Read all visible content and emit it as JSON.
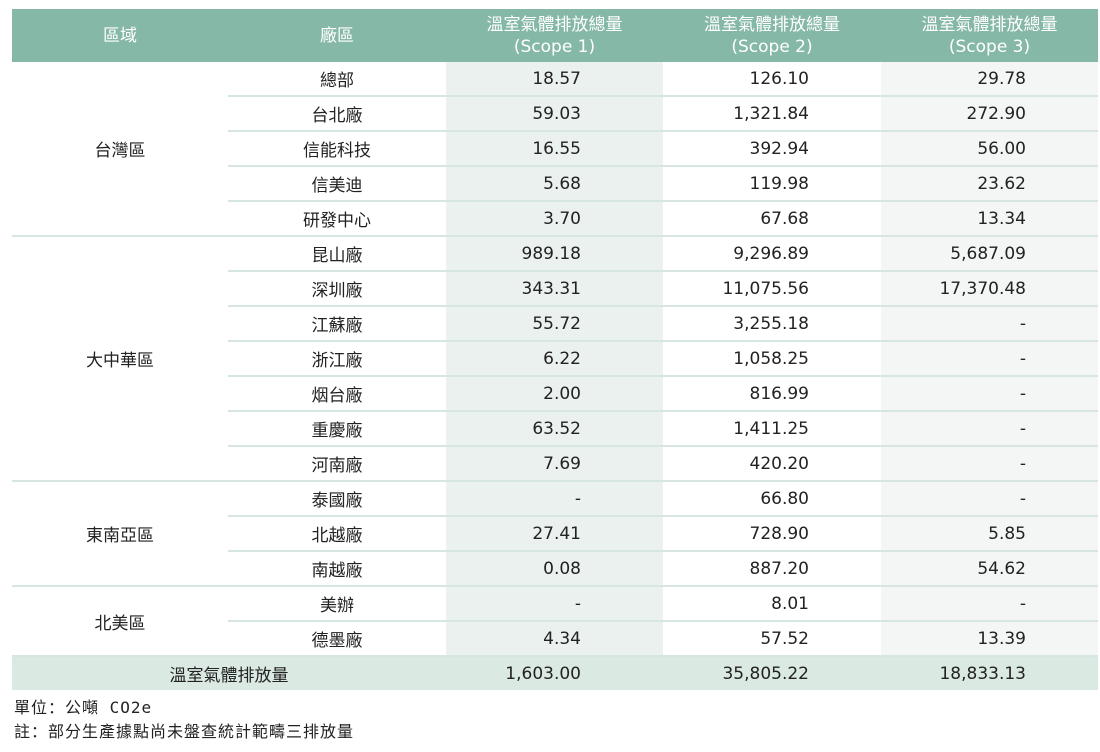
{
  "header": {
    "region": "區域",
    "plant": "廠區",
    "scope1_title": "溫室氣體排放總量",
    "scope1_sub": "(Scope 1)",
    "scope2_title": "溫室氣體排放總量",
    "scope2_sub": "(Scope 2)",
    "scope3_title": "溫室氣體排放總量",
    "scope3_sub": "(Scope 3)"
  },
  "groups": [
    {
      "region": "台灣區",
      "rows": [
        {
          "plant": "總部",
          "s1": "18.57",
          "s2": "126.10",
          "s3": "29.78"
        },
        {
          "plant": "台北廠",
          "s1": "59.03",
          "s2": "1,321.84",
          "s3": "272.90"
        },
        {
          "plant": "信能科技",
          "s1": "16.55",
          "s2": "392.94",
          "s3": "56.00"
        },
        {
          "plant": "信美迪",
          "s1": "5.68",
          "s2": "119.98",
          "s3": "23.62"
        },
        {
          "plant": "研發中心",
          "s1": "3.70",
          "s2": "67.68",
          "s3": "13.34"
        }
      ]
    },
    {
      "region": "大中華區",
      "rows": [
        {
          "plant": "昆山廠",
          "s1": "989.18",
          "s2": "9,296.89",
          "s3": "5,687.09"
        },
        {
          "plant": "深圳廠",
          "s1": "343.31",
          "s2": "11,075.56",
          "s3": "17,370.48"
        },
        {
          "plant": "江蘇廠",
          "s1": "55.72",
          "s2": "3,255.18",
          "s3": "-"
        },
        {
          "plant": "浙江廠",
          "s1": "6.22",
          "s2": "1,058.25",
          "s3": "-"
        },
        {
          "plant": "烟台廠",
          "s1": "2.00",
          "s2": "816.99",
          "s3": "-"
        },
        {
          "plant": "重慶廠",
          "s1": "63.52",
          "s2": "1,411.25",
          "s3": "-"
        },
        {
          "plant": "河南廠",
          "s1": "7.69",
          "s2": "420.20",
          "s3": "-"
        }
      ]
    },
    {
      "region": "東南亞區",
      "rows": [
        {
          "plant": "泰國廠",
          "s1": "-",
          "s2": "66.80",
          "s3": "-"
        },
        {
          "plant": "北越廠",
          "s1": "27.41",
          "s2": "728.90",
          "s3": "5.85"
        },
        {
          "plant": "南越廠",
          "s1": "0.08",
          "s2": "887.20",
          "s3": "54.62"
        }
      ]
    },
    {
      "region": "北美區",
      "rows": [
        {
          "plant": "美辦",
          "s1": "-",
          "s2": "8.01",
          "s3": "-"
        },
        {
          "plant": "德墨廠",
          "s1": "4.34",
          "s2": "57.52",
          "s3": "13.39"
        }
      ]
    }
  ],
  "total": {
    "label": "溫室氣體排放量",
    "s1": "1,603.00",
    "s2": "35,805.22",
    "s3": "18,833.13"
  },
  "notes": {
    "unit": "單位：公噸 CO2e",
    "remark": "註：部分生產據點尚未盤查統計範疇三排放量"
  },
  "colors": {
    "header_bg": "#86b8a8",
    "scope1_col_bg": "#ebf1ef",
    "scope3_col_bg": "#f3f6f5",
    "total_row_bg": "#dbe9e3",
    "row_border": "#d7e6e0"
  }
}
